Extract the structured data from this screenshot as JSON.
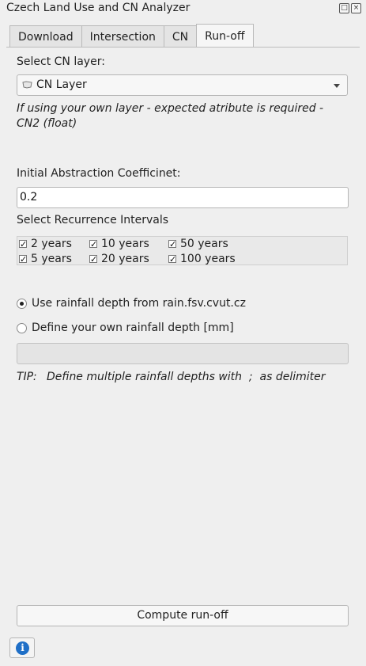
{
  "window": {
    "title": "Czech Land Use and CN Analyzer",
    "float_icon": "float-icon",
    "close_icon": "close-icon"
  },
  "tabs": [
    {
      "label": "Download",
      "active": false
    },
    {
      "label": "Intersection",
      "active": false
    },
    {
      "label": "CN",
      "active": false
    },
    {
      "label": "Run-off",
      "active": true
    }
  ],
  "cn_layer": {
    "label": "Select CN layer:",
    "selected": "CN Layer",
    "icon": "polygon-layer-icon",
    "note": "If using your own layer - expected atribute is required -CN2 (float)"
  },
  "abstraction": {
    "label": "Initial Abstraction Coefficinet:",
    "value": "0.2"
  },
  "recurrence": {
    "label": "Select Recurrence Intervals",
    "intervals": [
      {
        "label": "2 years",
        "checked": true
      },
      {
        "label": "10 years",
        "checked": true
      },
      {
        "label": "50 years",
        "checked": true
      },
      {
        "label": "5 years",
        "checked": true
      },
      {
        "label": "20 years",
        "checked": true
      },
      {
        "label": "100 years",
        "checked": true
      }
    ]
  },
  "rainfall": {
    "option_server": "Use rainfall depth from rain.fsv.cvut.cz",
    "option_own": "Define your own rainfall depth [mm]",
    "selected": "server",
    "own_value": "",
    "tip_label": "TIP:",
    "tip_text": "Define multiple rainfall depths with  ;  as delimiter"
  },
  "actions": {
    "compute_label": "Compute run-off",
    "info_icon": "info-icon"
  },
  "colors": {
    "background": "#efefef",
    "info_blue": "#1f6fc7"
  }
}
